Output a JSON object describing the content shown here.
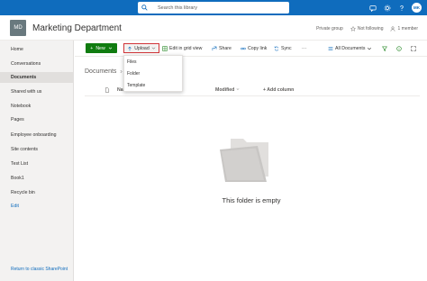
{
  "suitebar": {
    "search_placeholder": "Search this library",
    "user_initials": "MK"
  },
  "site": {
    "logo_initials": "MD",
    "title": "Marketing Department",
    "privacy": "Private group",
    "follow_label": "Not following",
    "members_label": "1 member"
  },
  "leftnav": {
    "items": [
      {
        "label": "Home"
      },
      {
        "label": "Conversations"
      },
      {
        "label": "Documents"
      },
      {
        "label": "Shared with us"
      },
      {
        "label": "Notebook"
      },
      {
        "label": "Pages"
      },
      {
        "label": "Employee onboarding"
      },
      {
        "label": "Site contents"
      },
      {
        "label": "Test List"
      },
      {
        "label": "Book1"
      },
      {
        "label": "Recycle bin"
      },
      {
        "label": "Edit"
      }
    ],
    "active_item": "Documents",
    "return_label": "Return to classic SharePoint"
  },
  "commandbar": {
    "new_label": "New",
    "upload_label": "Upload",
    "grid_label": "Edit in grid view",
    "share_label": "Share",
    "copylink_label": "Copy link",
    "sync_label": "Sync",
    "more_label": "···",
    "view_label": "All Documents"
  },
  "upload_menu": {
    "items": [
      {
        "label": "Files"
      },
      {
        "label": "Folder"
      },
      {
        "label": "Template"
      }
    ]
  },
  "main": {
    "breadcrumb": "Documents",
    "columns": {
      "name": "Name",
      "modified": "Modified",
      "add_column": "Add column"
    },
    "empty_message": "This folder is empty"
  },
  "colors": {
    "suitebar": "#0f6cbd",
    "new_button": "#107c10",
    "highlight_border": "#d13438",
    "nav_background": "#f3f2f1"
  }
}
